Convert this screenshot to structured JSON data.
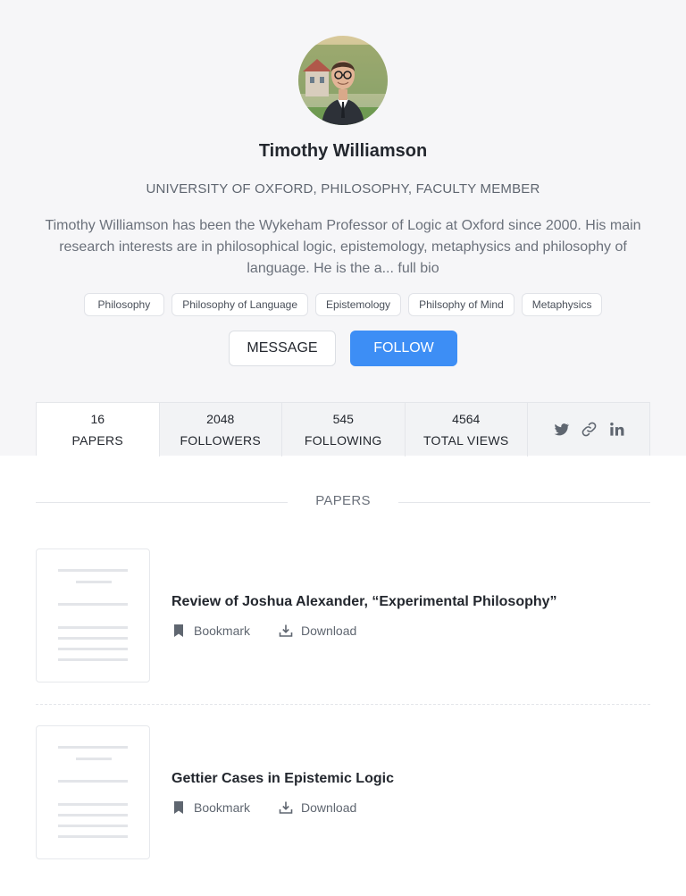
{
  "profile": {
    "name": "Timothy Williamson",
    "affiliation": "UNIVERSITY OF OXFORD, PHILOSOPHY, FACULTY MEMBER",
    "bio": "Timothy Williamson has been the Wykeham Professor of Logic at Oxford since 2000. His main research interests are in philosophical logic, epistemology, metaphysics and philosophy of language. He is the a... full bio",
    "tags": [
      "Philosophy",
      "Philosophy of Language",
      "Epistemology",
      "Philsophy of Mind",
      "Metaphysics"
    ]
  },
  "buttons": {
    "message": "MESSAGE",
    "follow": "FOLLOW"
  },
  "stats": [
    {
      "value": "16",
      "label": "PAPERS"
    },
    {
      "value": "2048",
      "label": "FOLLOWERS"
    },
    {
      "value": "545",
      "label": "FOLLOWING"
    },
    {
      "value": "4564",
      "label": "TOTAL VIEWS"
    }
  ],
  "social": [
    "twitter-icon",
    "link-icon",
    "linkedin-icon"
  ],
  "papers_section": {
    "title": "PAPERS",
    "items": [
      {
        "title": "Review of Joshua Alexander, “Experimental Philosophy”",
        "bookmark": "Bookmark",
        "download": "Download"
      },
      {
        "title": "Gettier Cases in Epistemic Logic",
        "bookmark": "Bookmark",
        "download": "Download"
      }
    ]
  },
  "colors": {
    "accent": "#3d8ef5",
    "header_bg": "#f6f6f8"
  }
}
